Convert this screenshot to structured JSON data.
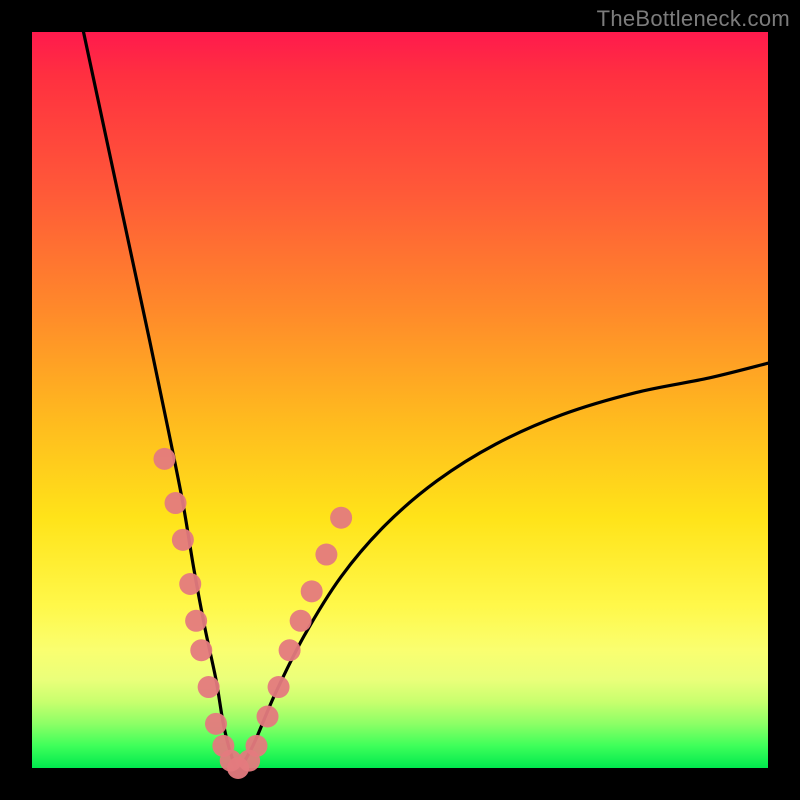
{
  "watermark": "TheBottleneck.com",
  "colors": {
    "gradient_top": "#ff1a4d",
    "gradient_mid1": "#ff8a2a",
    "gradient_mid2": "#ffe319",
    "gradient_bottom": "#00e84e",
    "curve": "#000000",
    "markers": "#e47a7e",
    "frame": "#000000"
  },
  "chart_data": {
    "type": "line",
    "title": "",
    "xlabel": "",
    "ylabel": "",
    "xlim": [
      0,
      100
    ],
    "ylim": [
      0,
      100
    ],
    "grid": false,
    "legend": false,
    "series": [
      {
        "name": "bottleneck-curve",
        "x": [
          7,
          10,
          13,
          16,
          18.5,
          20.5,
          22,
          23.5,
          25,
          26,
          27,
          28,
          30,
          33,
          37,
          42,
          48,
          55,
          63,
          72,
          82,
          92,
          100
        ],
        "y": [
          100,
          86,
          72,
          58,
          46,
          36,
          27,
          19,
          12,
          6,
          2,
          0,
          3,
          10,
          18,
          26,
          33,
          39,
          44,
          48,
          51,
          53,
          55
        ]
      }
    ],
    "markers": [
      {
        "x": 18.0,
        "y": 42
      },
      {
        "x": 19.5,
        "y": 36
      },
      {
        "x": 20.5,
        "y": 31
      },
      {
        "x": 21.5,
        "y": 25
      },
      {
        "x": 22.3,
        "y": 20
      },
      {
        "x": 23.0,
        "y": 16
      },
      {
        "x": 24.0,
        "y": 11
      },
      {
        "x": 25.0,
        "y": 6
      },
      {
        "x": 26.0,
        "y": 3
      },
      {
        "x": 27.0,
        "y": 1
      },
      {
        "x": 28.0,
        "y": 0
      },
      {
        "x": 29.5,
        "y": 1
      },
      {
        "x": 30.5,
        "y": 3
      },
      {
        "x": 32.0,
        "y": 7
      },
      {
        "x": 33.5,
        "y": 11
      },
      {
        "x": 35.0,
        "y": 16
      },
      {
        "x": 36.5,
        "y": 20
      },
      {
        "x": 38.0,
        "y": 24
      },
      {
        "x": 40.0,
        "y": 29
      },
      {
        "x": 42.0,
        "y": 34
      }
    ]
  }
}
